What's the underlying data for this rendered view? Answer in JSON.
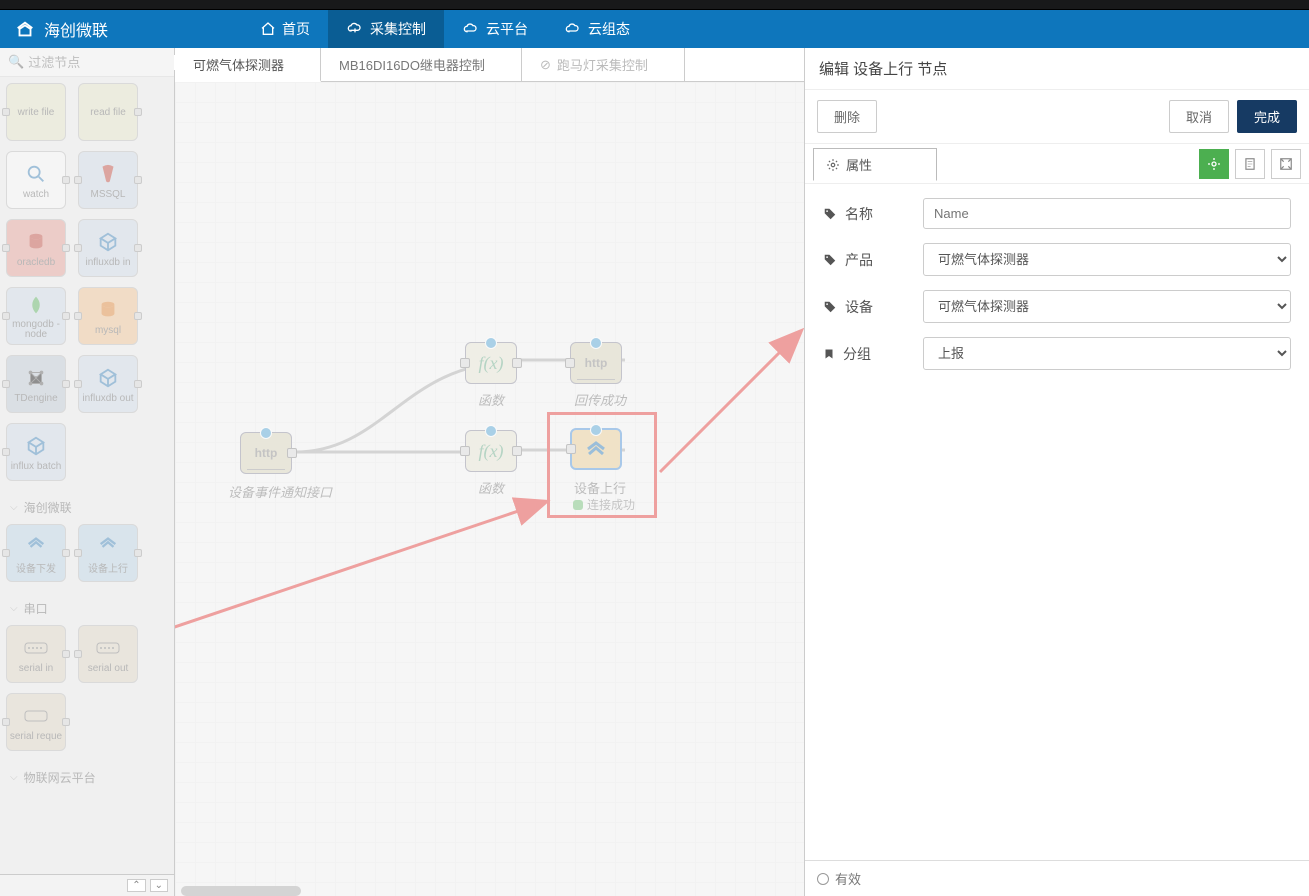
{
  "brand": "海创微联",
  "nav": {
    "home": "首页",
    "collect": "采集控制",
    "cloud": "云平台",
    "cloudcfg": "云组态"
  },
  "palette": {
    "search_placeholder": "过滤节点",
    "tiles": {
      "writefile": "write file",
      "readfile": "read file",
      "watch": "watch",
      "mssql": "MSSQL",
      "oracledb": "oracledb",
      "influxin": "influxdb in",
      "mongonode": "mongodb - node",
      "mysql": "mysql",
      "tdengine": "TDengine",
      "influxout": "influxdb out",
      "influxbatch": "influx batch",
      "dev_down": "设备下发",
      "dev_up": "设备上行",
      "serialin": "serial in",
      "serialout": "serial out",
      "serialreq": "serial reque"
    },
    "cat_hcwl": "海创微联",
    "cat_serial": "串口",
    "cat_iot": "物联网云平台"
  },
  "tabs": {
    "t1": "可燃气体探测器",
    "t2": "MB16DI16DO继电器控制",
    "t3": "跑马灯采集控制"
  },
  "canvas": {
    "http_in": "设备事件通知接口",
    "fn1": "函数",
    "fn2": "函数",
    "http_out": "回传成功",
    "dev_up": "设备上行",
    "status_conn": "连接成功"
  },
  "panel": {
    "title": "编辑 设备上行 节点",
    "delete": "删除",
    "cancel": "取消",
    "done": "完成",
    "props_tab": "属性",
    "f_name": "名称",
    "f_name_ph": "Name",
    "f_product": "产品",
    "f_product_val": "可燃气体探测器",
    "f_device": "设备",
    "f_device_val": "可燃气体探测器",
    "f_group": "分组",
    "f_group_val": "上报",
    "footer_valid": "有效"
  }
}
